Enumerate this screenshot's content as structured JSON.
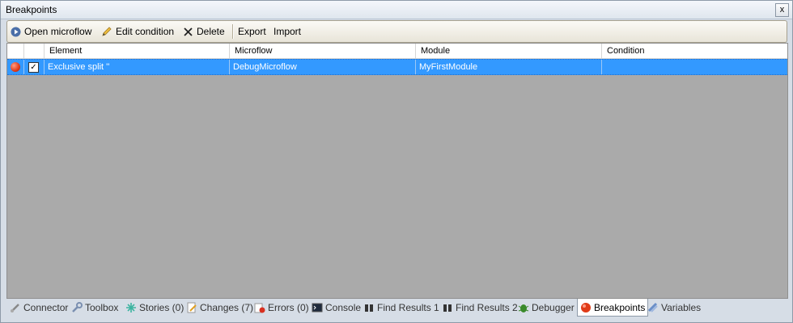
{
  "window": {
    "title": "Breakpoints",
    "close_glyph": "x"
  },
  "toolbar": {
    "open_microflow": "Open microflow",
    "edit_condition": "Edit condition",
    "delete": "Delete",
    "export": "Export",
    "import": "Import"
  },
  "grid": {
    "columns": {
      "element": "Element",
      "microflow": "Microflow",
      "module": "Module",
      "condition": "Condition"
    },
    "rows": [
      {
        "element": "Exclusive split ''",
        "microflow": "DebugMicroflow",
        "module": "MyFirstModule",
        "condition": "",
        "enabled": true,
        "selected": true
      }
    ]
  },
  "tabs": {
    "connector": "Connector",
    "toolbox": "Toolbox",
    "stories": "Stories (0)",
    "changes": "Changes (7)",
    "errors": "Errors (0)",
    "console": "Console",
    "find1": "Find Results 1",
    "find2": "Find Results 2",
    "debugger": "Debugger",
    "breakpoints": "Breakpoints",
    "variables": "Variables"
  },
  "colors": {
    "selection": "#3399ff",
    "grid_bg": "#aaaaaa",
    "breakpoint": "#e03b18"
  }
}
